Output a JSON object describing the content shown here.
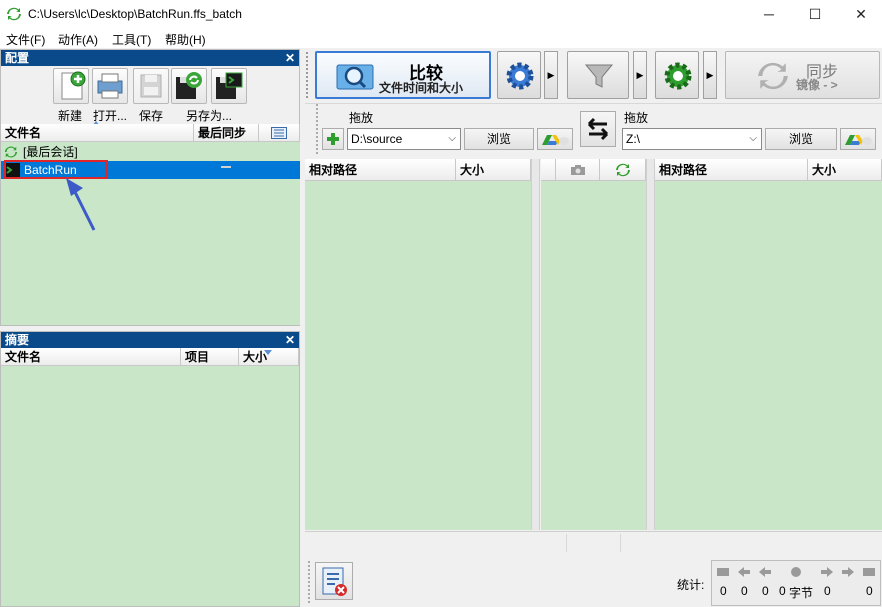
{
  "window": {
    "title": "C:\\Users\\lc\\Desktop\\BatchRun.ffs_batch"
  },
  "menu": [
    "文件(F)",
    "动作(A)",
    "工具(T)",
    "帮助(H)"
  ],
  "config_panel": {
    "title": "配置",
    "tools": [
      "新建",
      "打开...",
      "保存",
      "另存为..."
    ],
    "columns": {
      "name": "文件名",
      "last_sync": "最后同步"
    },
    "items": [
      "[最后会话]",
      "BatchRun"
    ],
    "selected": "BatchRun"
  },
  "summary_panel": {
    "title": "摘要",
    "columns": {
      "name": "文件名",
      "items": "项目",
      "size": "大小"
    }
  },
  "toolbar": {
    "compare_label": "比较",
    "compare_sub": "文件时间和大小",
    "sync_label": "同步",
    "sync_sub": "镜像 - >"
  },
  "folders": {
    "left": {
      "drop_label": "拖放",
      "path": "D:\\source",
      "browse": "浏览"
    },
    "right": {
      "drop_label": "拖放",
      "path": "Z:\\",
      "browse": "浏览"
    }
  },
  "grid": {
    "left_cols": {
      "path": "相对路径",
      "size": "大小"
    },
    "right_cols": {
      "path": "相对路径",
      "size": "大小"
    }
  },
  "stats": {
    "label": "统计:",
    "bytes_label": "字节",
    "values": [
      "0",
      "0",
      "0",
      "0",
      "0",
      "0"
    ]
  },
  "colors": {
    "accent": "#0a4a8a",
    "selected": "#0078d7",
    "grid_green": "#c9e6c9"
  }
}
